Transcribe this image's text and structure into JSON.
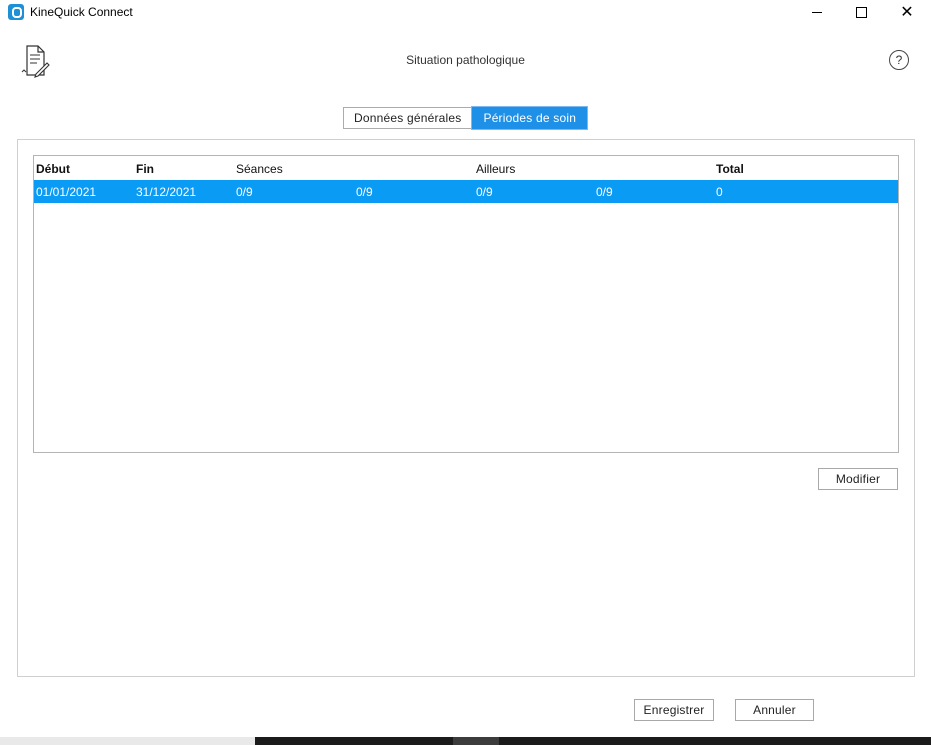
{
  "window": {
    "title": "KineQuick Connect",
    "icons": {
      "app": "kinequick-app-icon",
      "minimize": "minimize-icon",
      "maximize": "maximize-icon",
      "close": "close-icon"
    },
    "close_glyph": "✕"
  },
  "header": {
    "title": "Situation pathologique",
    "doc_icon": "document-edit-icon",
    "help_label": "?"
  },
  "tabs": [
    {
      "label": "Données générales",
      "active": false
    },
    {
      "label": "Périodes de soin",
      "active": true
    }
  ],
  "grid": {
    "columns": [
      "Début",
      "Fin",
      "Séances",
      "Ailleurs",
      "Total"
    ],
    "rows": [
      {
        "debut": "01/01/2021",
        "fin": "31/12/2021",
        "seances_a": "0/9",
        "seances_b": "0/9",
        "ailleurs_a": "0/9",
        "ailleurs_b": "0/9",
        "total": "0",
        "selected": true
      }
    ]
  },
  "buttons": {
    "modify": "Modifier",
    "save": "Enregistrer",
    "cancel": "Annuler"
  },
  "colors": {
    "accent": "#1e90e8",
    "selected_row": "#0a9bf5"
  }
}
